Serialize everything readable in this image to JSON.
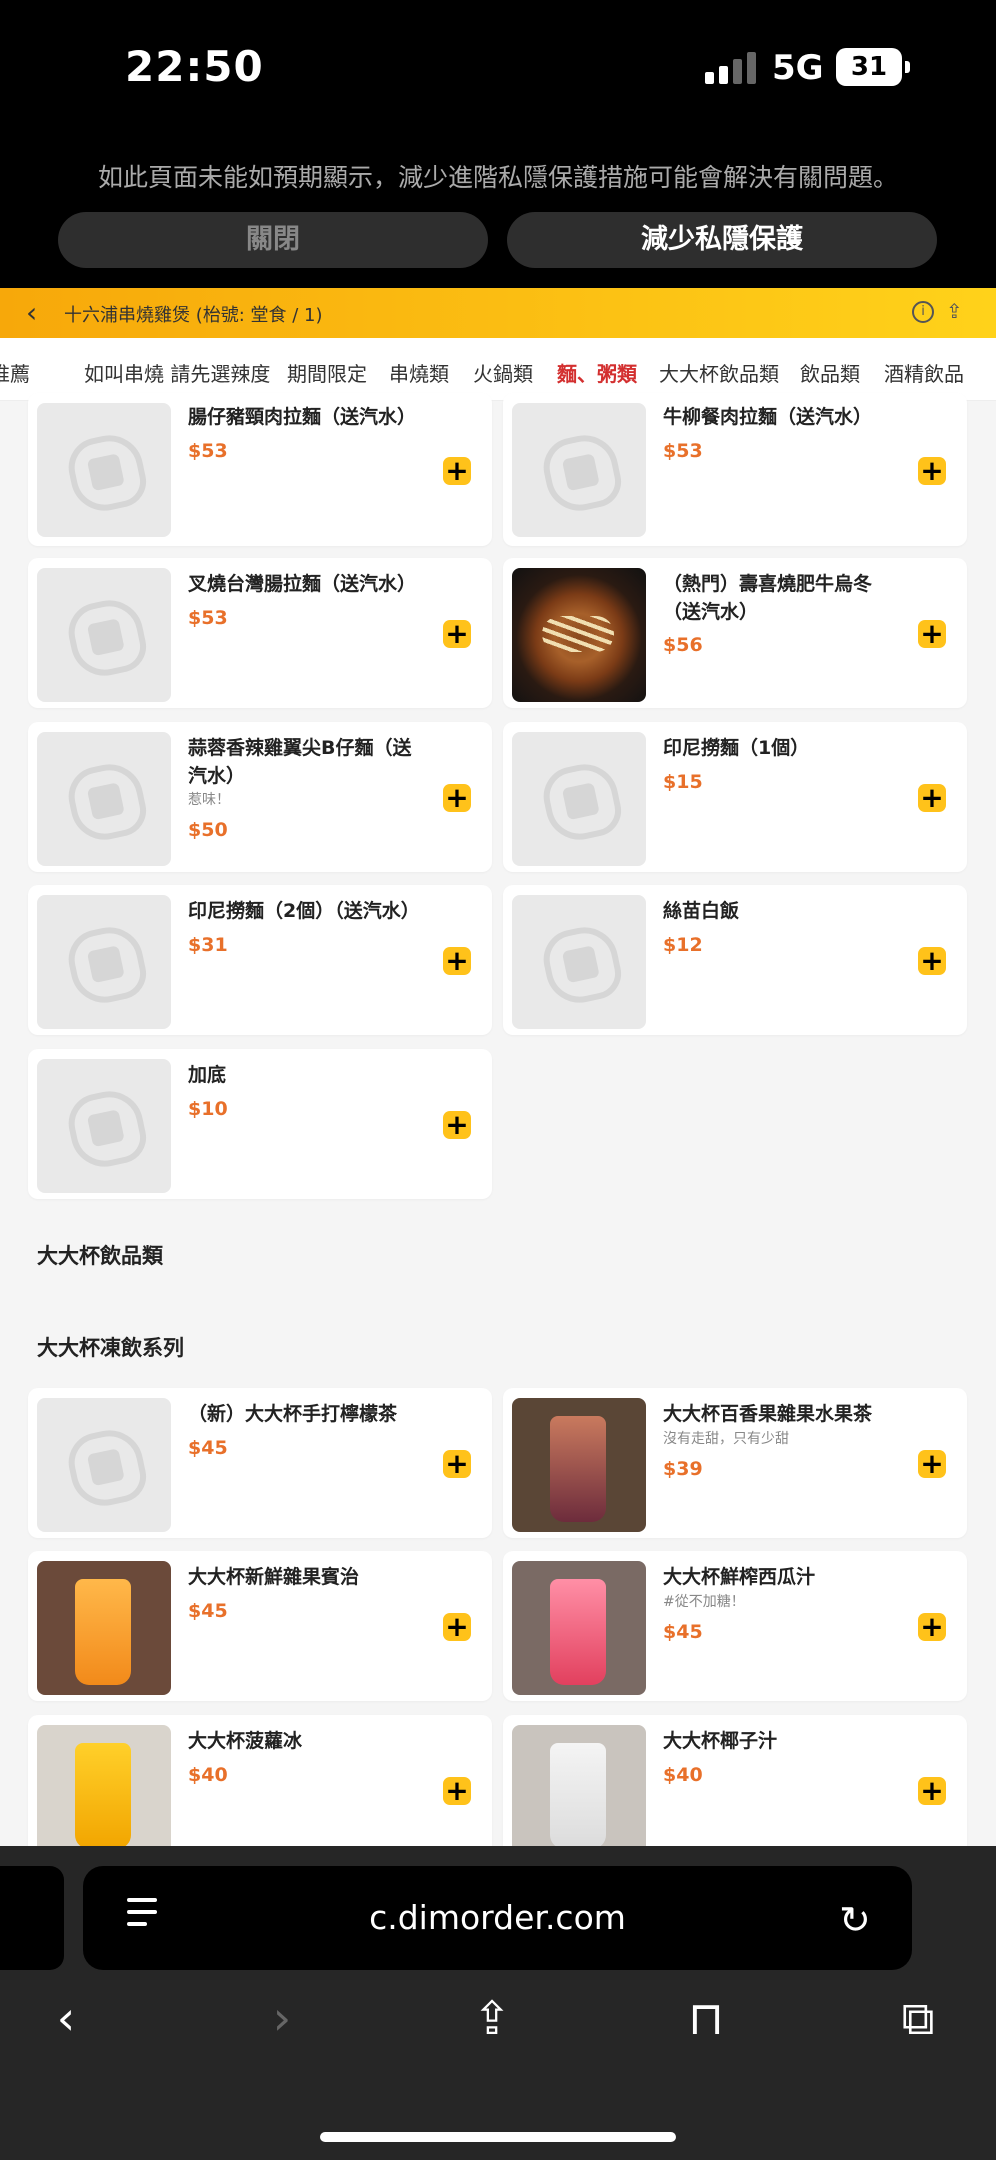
{
  "status": {
    "time": "22:50",
    "network": "5G",
    "battery": "31"
  },
  "privacy_banner": {
    "message": "如此頁面未能如預期顯示，減少進階私隱保護措施可能會解決有關問題。",
    "close_label": "關閉",
    "reduce_label": "減少私隱保護"
  },
  "shop": {
    "title": "十六浦串燒雞煲 (枱號: 堂食 / 1)"
  },
  "tabs": [
    "推薦",
    "如叫串燒 請先選辣度",
    "期間限定",
    "串燒類",
    "火鍋類",
    "麵、粥類",
    "大大杯飲品類",
    "飲品類",
    "酒精飲品"
  ],
  "active_tab": "麵、粥類",
  "noodle_items": [
    {
      "name": "腸仔豬頸肉拉麵（送汽水）",
      "price": "$53"
    },
    {
      "name": "牛柳餐肉拉麵（送汽水）",
      "price": "$53"
    },
    {
      "name": "叉燒台灣腸拉麵（送汽水）",
      "price": "$53"
    },
    {
      "name": "（熱門）壽喜燒肥牛烏冬（送汽水）",
      "price": "$56"
    },
    {
      "name": "蒜蓉香辣雞翼尖B仔麵（送汽水）",
      "note": "惹味！",
      "price": "$50"
    },
    {
      "name": "印尼撈麵（1個）",
      "price": "$15"
    },
    {
      "name": "印尼撈麵（2個）（送汽水）",
      "price": "$31"
    },
    {
      "name": "絲苗白飯",
      "price": "$12"
    },
    {
      "name": "加底",
      "price": "$10"
    }
  ],
  "section_drinks": "大大杯飲品類",
  "section_frozen": "大大杯凍飲系列",
  "drink_items": [
    {
      "name": "（新）大大杯手打檸檬茶",
      "price": "$45"
    },
    {
      "name": "大大杯百香果雜果水果茶",
      "note": "沒有走甜，只有少甜",
      "price": "$39"
    },
    {
      "name": "大大杯新鮮雜果賓治",
      "price": "$45"
    },
    {
      "name": "大大杯鮮榨西瓜汁",
      "note": "#從不加糖！",
      "price": "$45"
    },
    {
      "name": "大大杯菠蘿冰",
      "price": "$40"
    },
    {
      "name": "大大杯椰子汁",
      "price": "$40"
    }
  ],
  "browser": {
    "url": "c.dimorder.com"
  },
  "icons": {
    "back": "chevron-left-icon",
    "info": "info-icon",
    "share": "share-icon",
    "add": "plus-icon",
    "tabs": "tabs-icon",
    "bookmarks": "book-icon",
    "reload": "reload-icon"
  },
  "colors": {
    "accent": "#ffc21a",
    "price": "#e8702a",
    "active_tab": "#d32f2f",
    "header_start": "#f7a80a",
    "header_end": "#ffd21a"
  }
}
